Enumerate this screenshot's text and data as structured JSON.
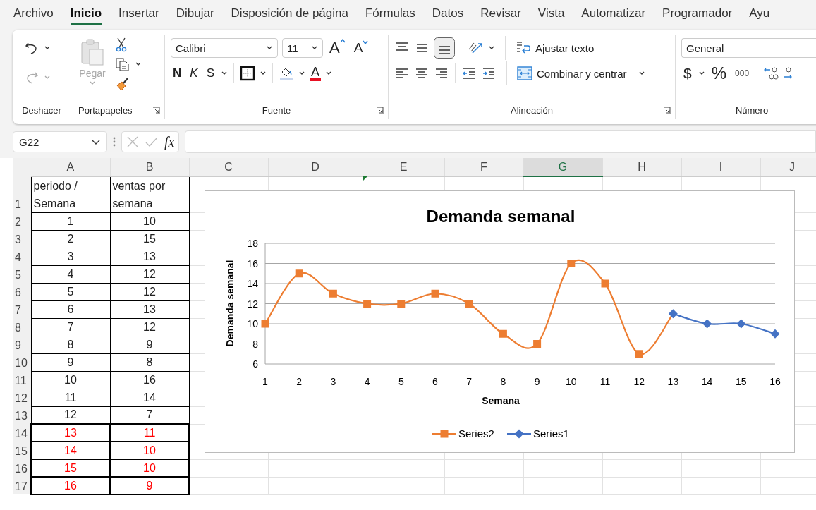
{
  "menu_tabs": [
    {
      "label": "Archivo",
      "selected": false
    },
    {
      "label": "Inicio",
      "selected": true
    },
    {
      "label": "Insertar",
      "selected": false
    },
    {
      "label": "Dibujar",
      "selected": false
    },
    {
      "label": "Disposición de página",
      "selected": false
    },
    {
      "label": "Fórmulas",
      "selected": false
    },
    {
      "label": "Datos",
      "selected": false
    },
    {
      "label": "Revisar",
      "selected": false
    },
    {
      "label": "Vista",
      "selected": false
    },
    {
      "label": "Automatizar",
      "selected": false
    },
    {
      "label": "Programador",
      "selected": false
    },
    {
      "label": "Ayu",
      "selected": false
    }
  ],
  "ribbon": {
    "undo": {
      "group_label": "Deshacer"
    },
    "clipboard": {
      "paste_label": "Pegar",
      "group_label": "Portapapeles"
    },
    "font": {
      "font_name": "Calibri",
      "font_size": "11",
      "grow_label": "A",
      "shrink_label": "A",
      "bold_label": "N",
      "italic_label": "K",
      "underline_label": "S",
      "font_color_label": "A",
      "group_label": "Fuente"
    },
    "alignment": {
      "wrap_text": "Ajustar texto",
      "merge_center": "Combinar y centrar",
      "group_label": "Alineación"
    },
    "number": {
      "format": "General",
      "currency": "$",
      "percent": "%",
      "thousands": "000",
      "group_label": "Número"
    }
  },
  "formula_bar": {
    "name_box": "G22",
    "fx": "fx"
  },
  "sheet": {
    "columns": [
      {
        "label": "A",
        "selected": false
      },
      {
        "label": "B",
        "selected": false
      },
      {
        "label": "C",
        "selected": false
      },
      {
        "label": "D",
        "selected": false
      },
      {
        "label": "E",
        "selected": false
      },
      {
        "label": "F",
        "selected": false
      },
      {
        "label": "G",
        "selected": true
      },
      {
        "label": "H",
        "selected": false
      },
      {
        "label": "I",
        "selected": false
      },
      {
        "label": "J",
        "selected": false
      }
    ],
    "rows": [
      {
        "number": "1",
        "cells": [
          "periodo / Semana",
          "ventas por semana"
        ],
        "highlighted": false
      },
      {
        "number": "2",
        "cells": [
          "1",
          "10"
        ],
        "highlighted": false
      },
      {
        "number": "3",
        "cells": [
          "2",
          "15"
        ],
        "highlighted": false
      },
      {
        "number": "4",
        "cells": [
          "3",
          "13"
        ],
        "highlighted": false
      },
      {
        "number": "5",
        "cells": [
          "4",
          "12"
        ],
        "highlighted": false
      },
      {
        "number": "6",
        "cells": [
          "5",
          "12"
        ],
        "highlighted": false
      },
      {
        "number": "7",
        "cells": [
          "6",
          "13"
        ],
        "highlighted": false
      },
      {
        "number": "8",
        "cells": [
          "7",
          "12"
        ],
        "highlighted": false
      },
      {
        "number": "9",
        "cells": [
          "8",
          "9"
        ],
        "highlighted": false
      },
      {
        "number": "10",
        "cells": [
          "9",
          "8"
        ],
        "highlighted": false
      },
      {
        "number": "11",
        "cells": [
          "10",
          "16"
        ],
        "highlighted": false
      },
      {
        "number": "12",
        "cells": [
          "11",
          "14"
        ],
        "highlighted": false
      },
      {
        "number": "13",
        "cells": [
          "12",
          "7"
        ],
        "highlighted": false
      },
      {
        "number": "14",
        "cells": [
          "13",
          "11"
        ],
        "highlighted": true
      },
      {
        "number": "15",
        "cells": [
          "14",
          "10"
        ],
        "highlighted": true
      },
      {
        "number": "16",
        "cells": [
          "15",
          "10"
        ],
        "highlighted": true
      },
      {
        "number": "17",
        "cells": [
          "16",
          "9"
        ],
        "highlighted": true
      }
    ]
  },
  "chart": {
    "chart_data": {
      "type": "line",
      "title": "Demanda semanal",
      "xlabel": "Semana",
      "ylabel": "Demanda semanal",
      "categories": [
        "1",
        "2",
        "3",
        "4",
        "5",
        "6",
        "7",
        "8",
        "9",
        "10",
        "11",
        "12",
        "13",
        "14",
        "15",
        "16"
      ],
      "series": [
        {
          "name": "Series2",
          "color": "#ed7d31",
          "marker": "square",
          "values": [
            10,
            15,
            13,
            12,
            12,
            13,
            12,
            9,
            8,
            16,
            14,
            7,
            11,
            null,
            null,
            null
          ]
        },
        {
          "name": "Series1",
          "color": "#4472c4",
          "marker": "diamond",
          "values": [
            null,
            null,
            null,
            null,
            null,
            null,
            null,
            null,
            null,
            null,
            null,
            null,
            11,
            10,
            10,
            9
          ]
        }
      ],
      "grid": true,
      "legend": true,
      "ylim": [
        6,
        18
      ],
      "yticks": [
        6,
        8,
        10,
        12,
        14,
        16,
        18
      ]
    }
  }
}
